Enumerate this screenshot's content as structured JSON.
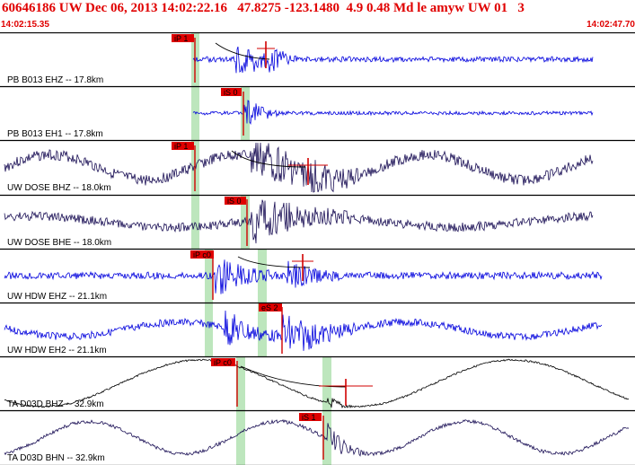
{
  "header": {
    "title": "60646186 UW Dec 06, 2013 14:02:22.16   47.8275 -123.1480  4.9 0.48 Md le amyw UW 01   3",
    "start_time": "14:02:15.35",
    "end_time": "14:02:47.70"
  },
  "colors": {
    "header_text": "#e00000",
    "pick_box": "#e00000",
    "window_bar": "#bde6bd",
    "trace_blue": "#0000dd",
    "trace_navy": "#1a0f55",
    "trace_black": "#000000",
    "pick_line": "#d00000"
  },
  "traces": [
    {
      "label": "PB B013 EHZ -- 17.8km",
      "color": "blue",
      "pick": "iP 1"
    },
    {
      "label": "PB B013 EH1 -- 17.8km",
      "color": "blue",
      "pick": "iS 0"
    },
    {
      "label": "UW DOSE BHZ -- 18.0km",
      "color": "navy",
      "pick": "iP 1"
    },
    {
      "label": "UW DOSE BHE -- 18.0km",
      "color": "navy",
      "pick": "iS 0"
    },
    {
      "label": "UW HDW EHZ -- 21.1km",
      "color": "blue",
      "pick": "iP c0"
    },
    {
      "label": "UW HDW EH2 -- 21.1km",
      "color": "blue",
      "pick": "eS 2"
    },
    {
      "label": "TA D03D BHZ -- 32.9km",
      "color": "black",
      "pick": "iP c0"
    },
    {
      "label": "TA D03D BHN -- 32.9km",
      "color": "navy",
      "pick": "iS 1"
    }
  ]
}
